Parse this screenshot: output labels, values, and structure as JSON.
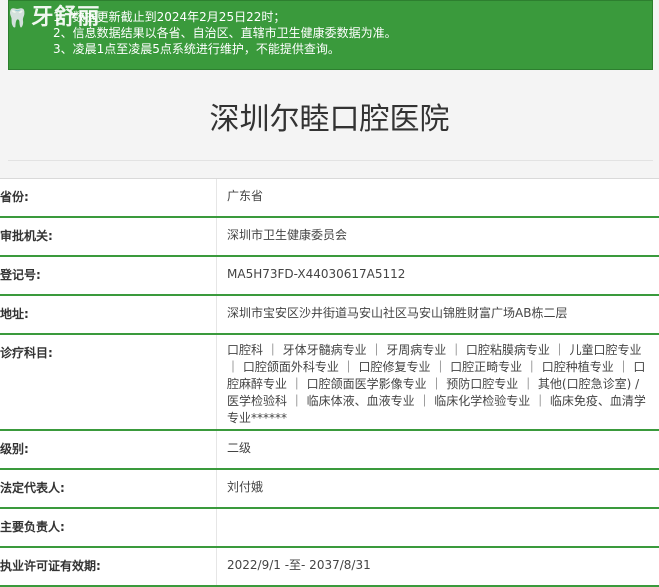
{
  "brand": {
    "logo_text": "牙舒丽"
  },
  "notice": {
    "lines": [
      "1、数据更新截止到2024年2月25日22时；",
      "2、信息数据结果以各省、自治区、直辖市卫生健康委数据为准。",
      "3、凌晨1点至凌晨5点系统进行维护，不能提供查询。"
    ]
  },
  "hospital": {
    "name": "深圳尔睦口腔医院"
  },
  "details": [
    {
      "label": "省份:",
      "value": "广东省"
    },
    {
      "label": "审批机关:",
      "value": "深圳市卫生健康委员会"
    },
    {
      "label": "登记号:",
      "value": "MA5H73FD-X44030617A5112"
    },
    {
      "label": "地址:",
      "value": "深圳市宝安区沙井街道马安山社区马安山锦胜财富广场AB栋二层"
    },
    {
      "label": "诊疗科目:",
      "value": "口腔科 ｜ 牙体牙髓病专业 ｜ 牙周病专业 ｜ 口腔粘膜病专业 ｜ 儿童口腔专业 ｜ 口腔颌面外科专业 ｜ 口腔修复专业 ｜ 口腔正畸专业 ｜ 口腔种植专业 ｜ 口腔麻醉专业 ｜ 口腔颌面医学影像专业 ｜ 预防口腔专业 ｜ 其他(口腔急诊室) /医学检验科 ｜ 临床体液、血液专业 ｜ 临床化学检验专业 ｜ 临床免疫、血清学专业******"
    },
    {
      "label": "级别:",
      "value": "二级"
    },
    {
      "label": "法定代表人:",
      "value": "刘付娥"
    },
    {
      "label": "主要负责人:",
      "value": ""
    },
    {
      "label": "执业许可证有效期:",
      "value": "2022/9/1 -至- 2037/8/31"
    }
  ],
  "colors": {
    "accent_green": "#3a9a3c",
    "text": "#333333"
  }
}
